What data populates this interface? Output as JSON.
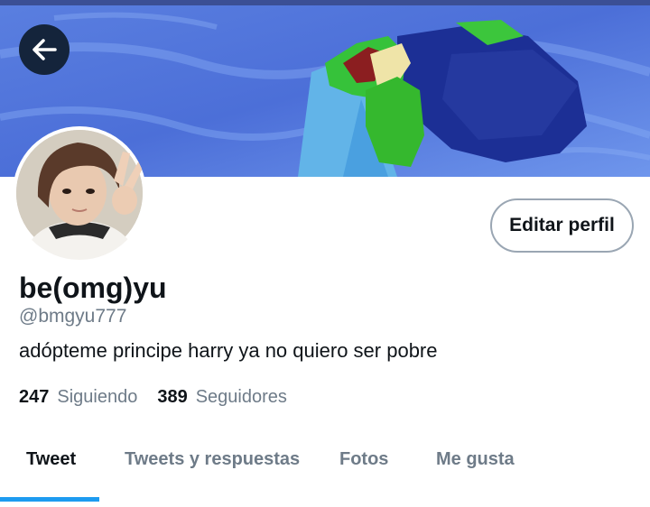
{
  "header": {
    "back_icon": "arrow-left-icon"
  },
  "profile": {
    "display_name": "be(omg)yu",
    "handle": "@bmgyu777",
    "bio": "adópteme principe harry ya no quiero ser pobre",
    "edit_label": "Editar perfil"
  },
  "stats": {
    "following_count": "247",
    "following_label": "Siguiendo",
    "followers_count": "389",
    "followers_label": "Seguidores"
  },
  "tabs": [
    {
      "label": "Tweet",
      "active": true
    },
    {
      "label": "Tweets y respuestas",
      "active": false
    },
    {
      "label": "Fotos",
      "active": false
    },
    {
      "label": "Me gusta",
      "active": false
    }
  ],
  "colors": {
    "accent": "#1d9bf0",
    "back_button_bg": "#14243b",
    "text_primary": "#0f1419",
    "text_secondary": "#6e7b88",
    "border": "#9aa6b3"
  }
}
